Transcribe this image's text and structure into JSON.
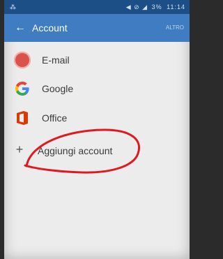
{
  "status_bar": {
    "left_glyph": "⁂",
    "icons": "◀ ⊘ ◢",
    "battery": "3%",
    "clock": "11:14"
  },
  "app_bar": {
    "back_icon": "←",
    "title": "Account",
    "more_label": "ALTRO"
  },
  "accounts": {
    "email": {
      "label": "E-mail",
      "icon": "email-icon"
    },
    "google": {
      "label": "Google",
      "icon": "google-g-icon"
    },
    "office": {
      "label": "Office",
      "icon": "office-icon"
    }
  },
  "add_account": {
    "icon": "+",
    "label": "Aggiungi account"
  },
  "colors": {
    "status_bar": "#1b4f86",
    "app_bar": "#3f7cc2",
    "background": "#ececec",
    "annotation": "#e0191f",
    "office": "#d83b01"
  }
}
